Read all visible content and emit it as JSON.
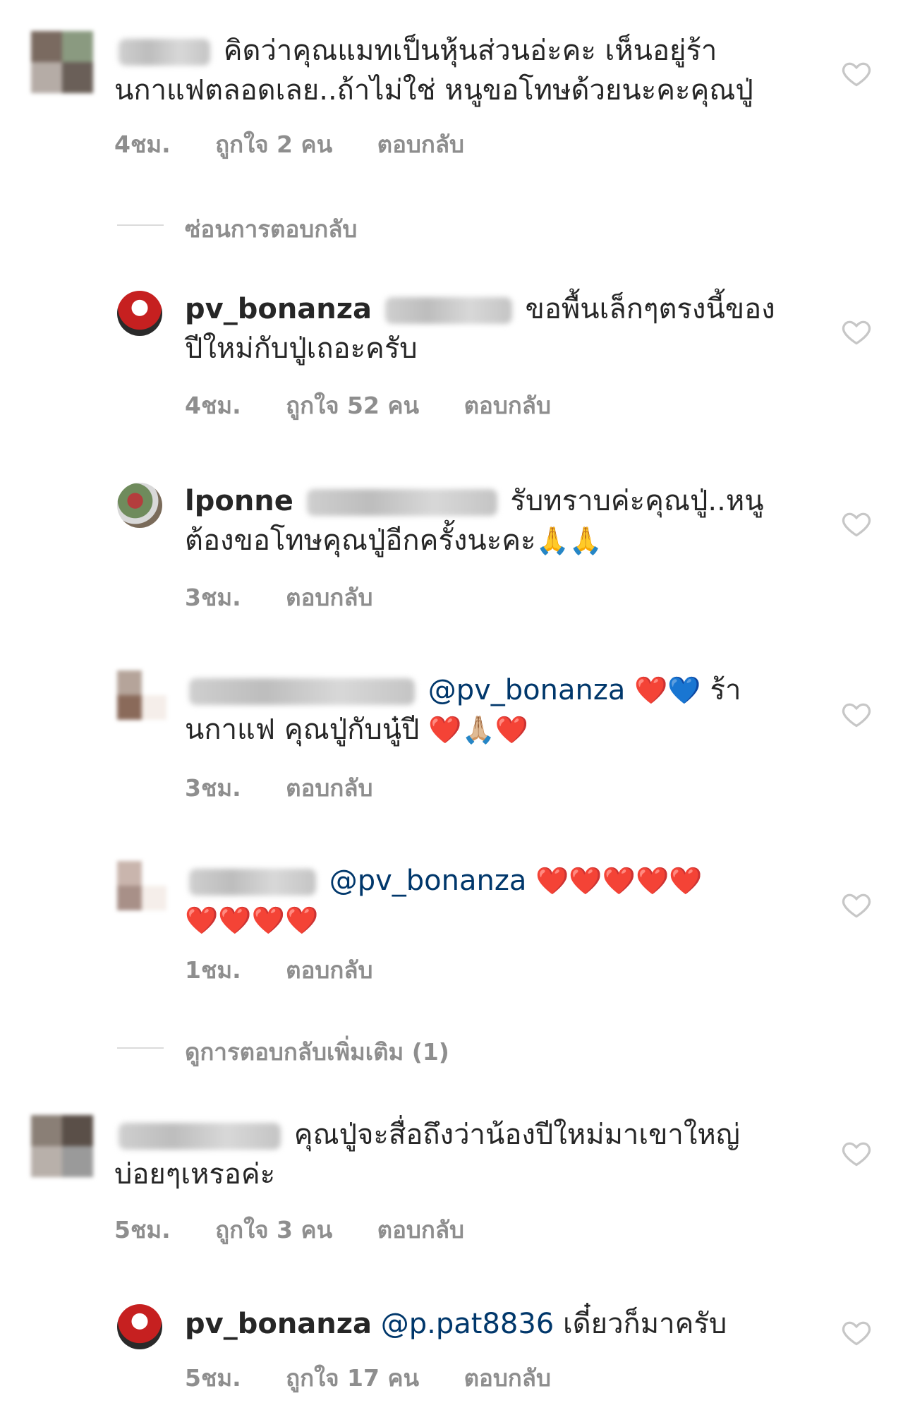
{
  "comments": [
    {
      "avatar_colors": [
        "#7a6a60",
        "#8a9a80",
        "#b5aca6",
        "#6a5f58"
      ],
      "text": "คิดว่าคุณแมทเป็นหุ้นส่วนอ่ะคะ เห็นอยู่ร้า",
      "text2": "นกาแฟตลอดเลย..ถ้าไม่ใช่ หนูขอโทษด้วยนะคะคุณปู่",
      "time": "4ชม.",
      "likes": "ถูกใจ 2 คน",
      "reply": "ตอบกลับ"
    },
    {
      "toggle": "ซ่อนการตอบกลับ"
    },
    {
      "username": "pv_bonanza",
      "text": "ขอพื้นเล็กๆตรงนี้ของ",
      "text2": "ปีใหม่กับปู่เถอะครับ",
      "time": "4ชม.",
      "likes": "ถูกใจ 52 คน",
      "reply": "ตอบกลับ"
    },
    {
      "username": "lponne",
      "text": "รับทราบค่ะคุณปู่..หนู",
      "text2": "ต้องขอโทษคุณปู่อีกครั้งนะคะ",
      "emoji": "🙏🙏",
      "time": "3ชม.",
      "reply": "ตอบกลับ"
    },
    {
      "avatar_colors": [
        "#b5a49a",
        "#ffffff",
        "#8a6a5a",
        "#f5eeea"
      ],
      "mention": "@pv_bonanza",
      "emoji1": "❤️💙",
      "text": "ร้า",
      "text2": "นกาแฟ คุณปู่กับนู๋ปี",
      "emoji2": [
        "❤️",
        "🙏🏼",
        "❤️"
      ],
      "time": "3ชม.",
      "reply": "ตอบกลับ"
    },
    {
      "avatar_colors": [
        "#c9b5ad",
        "#ffffff",
        "#a89088",
        "#f5eeea"
      ],
      "mention": "@pv_bonanza",
      "hearts_line1": "❤️❤️❤️❤️❤️",
      "hearts_line2": "❤️❤️❤️❤️",
      "time": "1ชม.",
      "reply": "ตอบกลับ"
    },
    {
      "toggle": "ดูการตอบกลับเพิ่มเติม (1)"
    },
    {
      "avatar_colors": [
        "#8a7f76",
        "#5a4f48",
        "#b8b0aa",
        "#9a9a9a"
      ],
      "text": "คุณปู่จะสื่อถึงว่าน้องปีใหม่มาเขาใหญ่",
      "text2": "บ่อยๆเหรอค่ะ",
      "time": "5ชม.",
      "likes": "ถูกใจ 3 คน",
      "reply": "ตอบกลับ"
    },
    {
      "username": "pv_bonanza",
      "mention": "@p.pat8836",
      "text": "เดี๋ยวก็มาครับ",
      "time": "5ชม.",
      "likes": "ถูกใจ 17 คน",
      "reply": "ตอบกลับ"
    }
  ],
  "icons": {
    "like": "heart-outline-icon"
  }
}
